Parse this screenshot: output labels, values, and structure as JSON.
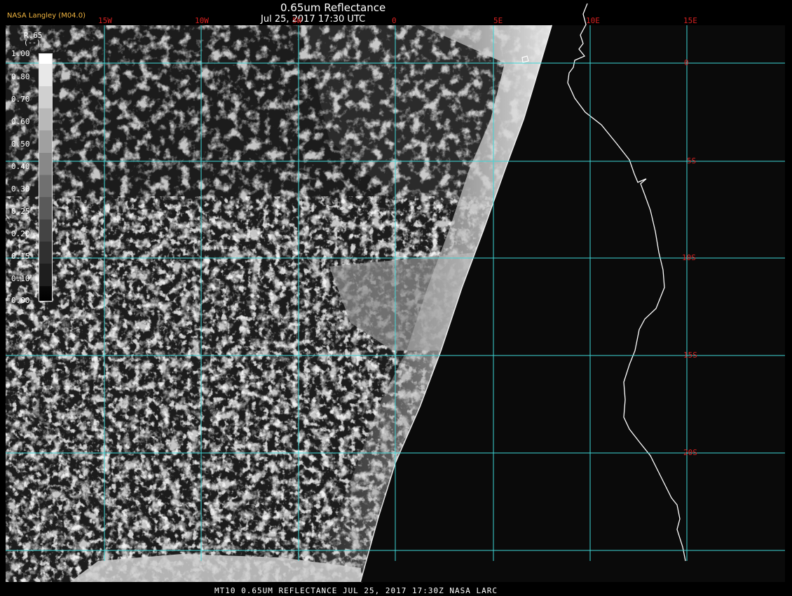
{
  "header": {
    "title": "0.65um Reflectance",
    "datetime": "Jul 25, 2017 17:30 UTC",
    "credit": "NASA Langley (M04.0)"
  },
  "grid": {
    "line_color": "#3fd7d7",
    "label_color": "#d62020",
    "lon_labels": [
      "15W",
      "10W",
      "5W",
      "0",
      "5E",
      "10E",
      "15E"
    ],
    "lat_labels": [
      "0",
      "5S",
      "10S",
      "15S",
      "20S"
    ]
  },
  "legend": {
    "title": "R.65",
    "unit": "(--)",
    "ticks": [
      "1.00",
      "0.80",
      "0.70",
      "0.60",
      "0.50",
      "0.40",
      "0.30",
      "0.25",
      "0.20",
      "0.15",
      "0.10",
      "0.00"
    ]
  },
  "footer": {
    "text": "MT10  0.65UM REFLECTANCE   JUL 25, 2017 17:30Z   NASA LARC"
  },
  "colors": {
    "coastline": "#ffffff",
    "background": "#000000",
    "credit": "#f2b640"
  }
}
